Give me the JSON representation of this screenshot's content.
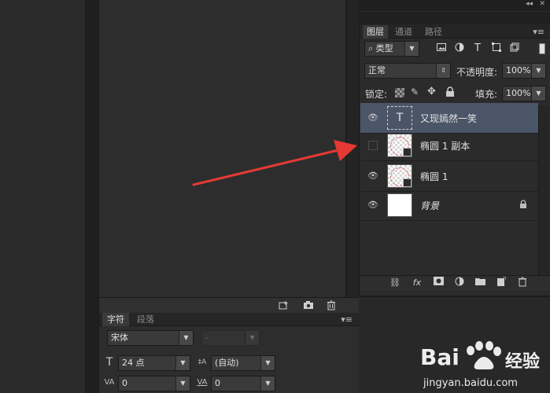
{
  "layers_panel": {
    "tabs": [
      "图层",
      "通道",
      "路径"
    ],
    "filter_label": "类型",
    "blend_mode": "正常",
    "opacity_label": "不透明度:",
    "opacity_value": "100%",
    "lock_label": "锁定:",
    "fill_label": "填充:",
    "fill_value": "100%",
    "layers": [
      {
        "name": "又现嫣然一笑",
        "type": "text",
        "visible": true,
        "selected": true
      },
      {
        "name": "椭圆 1 副本",
        "type": "shape",
        "visible": false,
        "selected": false
      },
      {
        "name": "椭圆 1",
        "type": "shape",
        "visible": true,
        "selected": false
      },
      {
        "name": "背景",
        "type": "background",
        "visible": true,
        "selected": false,
        "locked": true
      }
    ]
  },
  "character_panel": {
    "tabs": [
      "字符",
      "段落"
    ],
    "font_family": "宋体",
    "font_style": "-",
    "font_size": "24 点",
    "leading": "(自动)",
    "kerning": "0",
    "tracking": "0"
  },
  "watermark": {
    "brand": "Bai",
    "brand_suffix": "经验",
    "url": "jingyan.baidu.com"
  },
  "colors": {
    "selected_layer": "#4b5568",
    "arrow": "#e53935",
    "panel_bg": "#2b2b2b"
  },
  "icons": {
    "filter": [
      "image-filter-icon",
      "adjustment-filter-icon",
      "type-filter-icon",
      "shape-filter-icon",
      "smart-object-filter-icon"
    ],
    "footer": [
      "link-layers-icon",
      "fx-icon",
      "add-mask-icon",
      "adjustment-layer-icon",
      "new-group-icon",
      "new-layer-icon",
      "delete-layer-icon"
    ]
  }
}
